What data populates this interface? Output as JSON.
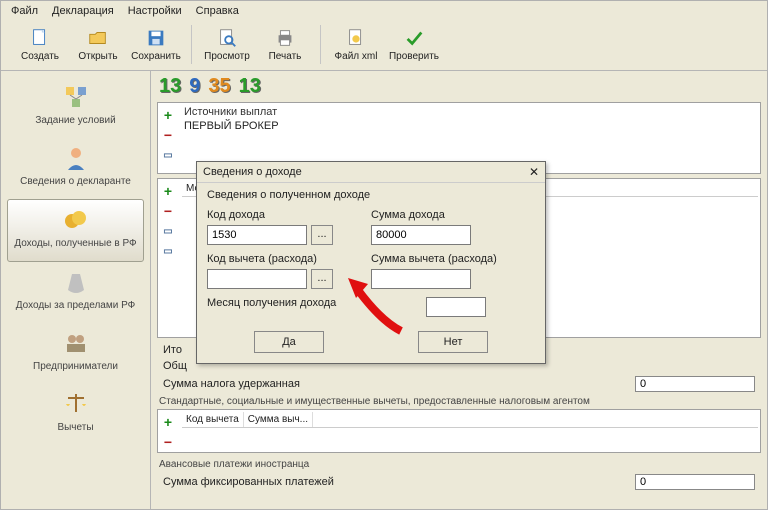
{
  "menu": {
    "file": "Файл",
    "decl": "Декларация",
    "settings": "Настройки",
    "help": "Справка"
  },
  "toolbar": {
    "create": "Создать",
    "open": "Открыть",
    "save": "Сохранить",
    "preview": "Просмотр",
    "print": "Печать",
    "filexml": "Файл xml",
    "check": "Проверить"
  },
  "sidebar": {
    "task": "Задание условий",
    "declarant": "Сведения о декларанте",
    "income_rf": "Доходы, полученные в РФ",
    "income_abroad": "Доходы за пределами РФ",
    "entrepreneurs": "Предприниматели",
    "deductions": "Вычеты"
  },
  "numbers": {
    "a": "13",
    "b": "9",
    "c": "35",
    "d": "13"
  },
  "sources": {
    "header": "Источники выплат",
    "row1": "ПЕРВЫЙ БРОКЕР"
  },
  "month_header": "Ме",
  "summary": {
    "ito": "Ито",
    "obsh": "Общ",
    "tax_withheld": "Сумма налога удержанная",
    "tax_val": "0"
  },
  "deductions_panel": {
    "title": "Стандартные, социальные и имущественные вычеты, предоставленные налоговым агентом",
    "col1": "Код вычета",
    "col2": "Сумма выч..."
  },
  "advance": {
    "title": "Авансовые платежи иностранца",
    "label": "Сумма фиксированных платежей",
    "value": "0"
  },
  "dialog": {
    "title": "Сведения о доходе",
    "subtitle": "Сведения о полученном доходе",
    "income_code_lbl": "Код дохода",
    "income_code_val": "1530",
    "income_sum_lbl": "Сумма дохода",
    "income_sum_val": "80000",
    "ded_code_lbl": "Код вычета (расхода)",
    "ded_sum_lbl": "Сумма вычета (расхода)",
    "month_lbl": "Месяц получения дохода",
    "yes": "Да",
    "no": "Нет",
    "dots": "..."
  }
}
